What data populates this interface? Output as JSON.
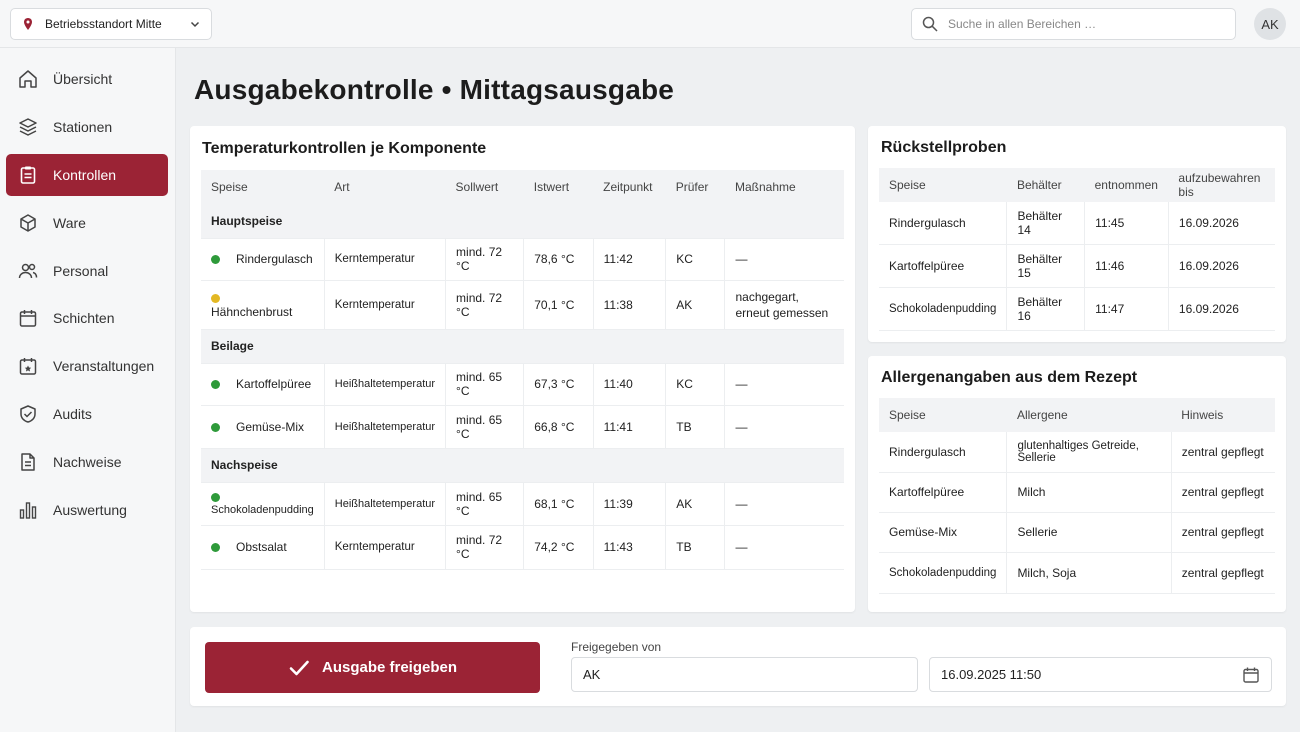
{
  "topbar": {
    "location": "Betriebsstandort Mitte",
    "search_placeholder": "Suche in allen Bereichen …",
    "avatar": "AK"
  },
  "sidebar": {
    "items": [
      {
        "label": "Übersicht",
        "icon": "home-icon"
      },
      {
        "label": "Stationen",
        "icon": "layers-icon"
      },
      {
        "label": "Kontrollen",
        "icon": "clipboard-icon",
        "active": true
      },
      {
        "label": "Ware",
        "icon": "box-icon"
      },
      {
        "label": "Personal",
        "icon": "users-icon"
      },
      {
        "label": "Schichten",
        "icon": "calendar-icon"
      },
      {
        "label": "Veranstaltungen",
        "icon": "calendar-star-icon"
      },
      {
        "label": "Audits",
        "icon": "shield-check-icon"
      },
      {
        "label": "Nachweise",
        "icon": "document-icon"
      },
      {
        "label": "Auswertung",
        "icon": "bar-chart-icon"
      }
    ]
  },
  "page": {
    "title": "Ausgabekontrolle • Mittagsausgabe"
  },
  "temp": {
    "title": "Temperaturkontrollen je Komponente",
    "headers": [
      "Speise",
      "Art",
      "Sollwert",
      "Istwert",
      "Zeitpunkt",
      "Prüfer",
      "Maßnahme"
    ],
    "groups": [
      {
        "name": "Hauptspeise",
        "rows": [
          {
            "status": "green",
            "speise": "Rindergulasch",
            "art": "Kerntemperatur",
            "soll": "mind. 72 °C",
            "ist": "78,6 °C",
            "zeit": "11:42",
            "pruefer": "KC",
            "massnahme": "—"
          },
          {
            "status": "yellow",
            "speise": "Hähnchenbrust",
            "art": "Kerntemperatur",
            "soll": "mind. 72 °C",
            "ist": "70,1 °C",
            "zeit": "11:38",
            "pruefer": "AK",
            "massnahme": "nachgegart, erneut gemessen"
          }
        ]
      },
      {
        "name": "Beilage",
        "rows": [
          {
            "status": "green",
            "speise": "Kartoffelpüree",
            "art": "Heißhaltetemperatur",
            "soll": "mind. 65 °C",
            "ist": "67,3 °C",
            "zeit": "11:40",
            "pruefer": "KC",
            "massnahme": "—"
          },
          {
            "status": "green",
            "speise": "Gemüse-Mix",
            "art": "Heißhaltetemperatur",
            "soll": "mind. 65 °C",
            "ist": "66,8 °C",
            "zeit": "11:41",
            "pruefer": "TB",
            "massnahme": "—"
          }
        ]
      },
      {
        "name": "Nachspeise",
        "rows": [
          {
            "status": "green",
            "speise": "Schokoladenpudding",
            "art": "Heißhaltetemperatur",
            "soll": "mind. 65 °C",
            "ist": "68,1 °C",
            "zeit": "11:39",
            "pruefer": "AK",
            "massnahme": "—"
          },
          {
            "status": "green",
            "speise": "Obstsalat",
            "art": "Kerntemperatur",
            "soll": "mind. 72 °C",
            "ist": "74,2 °C",
            "zeit": "11:43",
            "pruefer": "TB",
            "massnahme": "—"
          }
        ]
      }
    ]
  },
  "samples": {
    "title": "Rückstellproben",
    "headers": [
      "Speise",
      "Behälter",
      "entnommen",
      "aufzubewahren bis"
    ],
    "rows": [
      [
        "Rindergulasch",
        "Behälter 14",
        "11:45",
        "16.09.2026"
      ],
      [
        "Kartoffelpüree",
        "Behälter 15",
        "11:46",
        "16.09.2026"
      ],
      [
        "Schokoladenpudding",
        "Behälter 16",
        "11:47",
        "16.09.2026"
      ]
    ]
  },
  "allergens": {
    "title": "Allergenangaben aus dem Rezept",
    "headers": [
      "Speise",
      "Allergene",
      "Hinweis"
    ],
    "rows": [
      [
        "Rindergulasch",
        "glutenhaltiges Getreide, Sellerie",
        "zentral gepflegt"
      ],
      [
        "Kartoffelpüree",
        "Milch",
        "zentral gepflegt"
      ],
      [
        "Gemüse-Mix",
        "Sellerie",
        "zentral gepflegt"
      ],
      [
        "Schokoladenpudding",
        "Milch, Soja",
        "zentral gepflegt"
      ]
    ]
  },
  "release": {
    "button": "Ausgabe freigeben",
    "released_by_label": "Freigegeben von",
    "released_by": "AK",
    "datetime": "16.09.2025 11:50"
  },
  "colors": {
    "accent": "#9b2335",
    "ok": "#2e9a3a",
    "warn": "#e3b824"
  }
}
